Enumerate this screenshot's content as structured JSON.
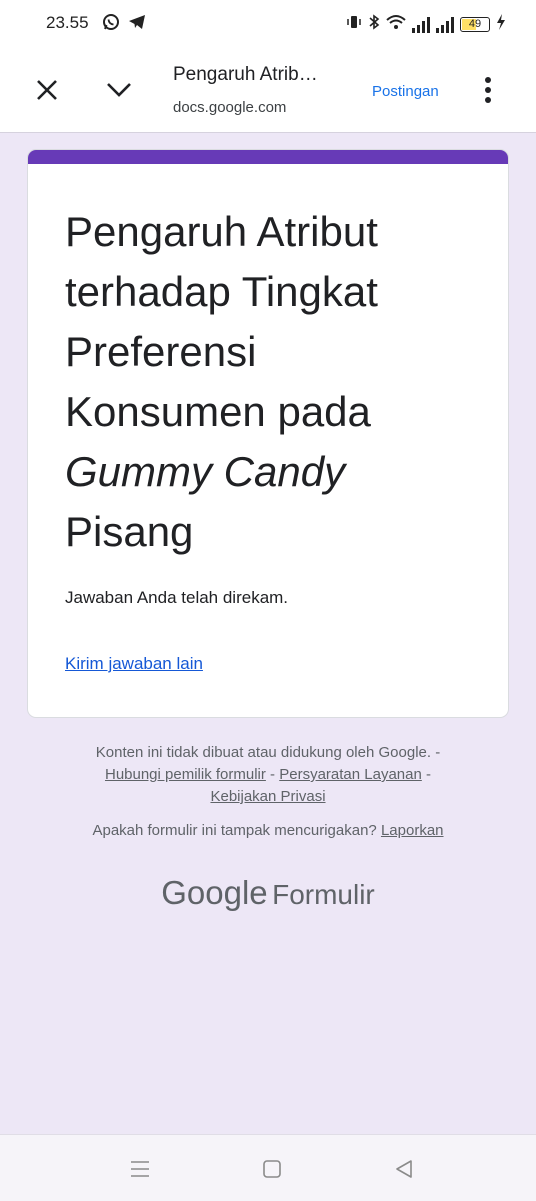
{
  "status_bar": {
    "time": "23.55",
    "battery_level": "49",
    "icons": [
      "whatsapp-icon",
      "telegram-icon",
      "vibrate-icon",
      "bluetooth-icon",
      "wifi-icon",
      "signal-icon",
      "signal-icon",
      "battery-icon",
      "charging-icon"
    ]
  },
  "toolbar": {
    "title": "Pengaruh Atrib…",
    "url": "docs.google.com",
    "action_label": "Postingan"
  },
  "card": {
    "title_lines": [
      "Pengaruh Atribut",
      "terhadap Tingkat",
      "Preferensi",
      "Konsumen pada"
    ],
    "title_italic": "Gummy Candy",
    "title_last": "Pisang",
    "confirmation": "Jawaban Anda telah direkam.",
    "another_response_link": "Kirim jawaban lain"
  },
  "footer": {
    "disclaimer": "Konten ini tidak dibuat atau didukung oleh Google.",
    "sep": " - ",
    "contact_owner": "Hubungi pemilik formulir",
    "terms": "Persyaratan Layanan",
    "privacy": "Kebijakan Privasi",
    "report_question": "Apakah formulir ini tampak mencurigakan?",
    "report_link": "Laporkan",
    "brand_google": "Google",
    "brand_product": "Formulir"
  },
  "colors": {
    "accent": "#673ab7",
    "background": "#ede7f6",
    "link": "#1558d6",
    "action": "#1a73e8"
  }
}
